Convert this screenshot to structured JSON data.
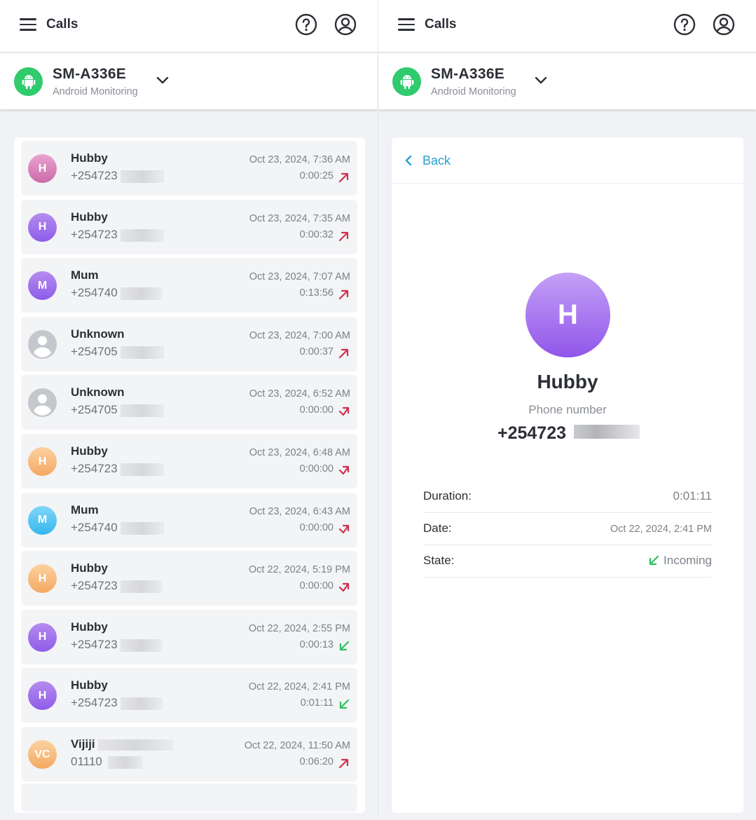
{
  "header": {
    "title": "Calls"
  },
  "device": {
    "name": "SM-A336E",
    "subtitle": "Android Monitoring"
  },
  "calls": [
    {
      "name": "Hubby",
      "number": "+254723",
      "date": "Oct 23, 2024, 7:36 AM",
      "duration": "0:00:25",
      "direction": "outgoing",
      "avatar_initials": "H",
      "avatar_color": "#c96aa8"
    },
    {
      "name": "Hubby",
      "number": "+254723",
      "date": "Oct 23, 2024, 7:35 AM",
      "duration": "0:00:32",
      "direction": "outgoing",
      "avatar_initials": "H",
      "avatar_color": "#8e5ce8"
    },
    {
      "name": "Mum",
      "number": "+254740",
      "date": "Oct 23, 2024, 7:07 AM",
      "duration": "0:13:56",
      "direction": "outgoing",
      "avatar_initials": "M",
      "avatar_color": "#8e5ce8"
    },
    {
      "name": "Unknown",
      "number": "+254705",
      "date": "Oct 23, 2024, 7:00 AM",
      "duration": "0:00:37",
      "direction": "outgoing",
      "avatar_initials": "",
      "avatar_color": "#c4c7cc"
    },
    {
      "name": "Unknown",
      "number": "+254705",
      "date": "Oct 23, 2024, 6:52 AM",
      "duration": "0:00:00",
      "direction": "missed-outgoing",
      "avatar_initials": "",
      "avatar_color": "#c4c7cc"
    },
    {
      "name": "Hubby",
      "number": "+254723",
      "date": "Oct 23, 2024, 6:48 AM",
      "duration": "0:00:00",
      "direction": "missed-outgoing",
      "avatar_initials": "H",
      "avatar_color": "#f5a962"
    },
    {
      "name": "Mum",
      "number": "+254740",
      "date": "Oct 23, 2024, 6:43 AM",
      "duration": "0:00:00",
      "direction": "missed-outgoing",
      "avatar_initials": "M",
      "avatar_color": "#35b7ef"
    },
    {
      "name": "Hubby",
      "number": "+254723",
      "date": "Oct 22, 2024, 5:19 PM",
      "duration": "0:00:00",
      "direction": "missed-outgoing",
      "avatar_initials": "H",
      "avatar_color": "#f5a962"
    },
    {
      "name": "Hubby",
      "number": "+254723",
      "date": "Oct 22, 2024, 2:55 PM",
      "duration": "0:00:13",
      "direction": "incoming",
      "avatar_initials": "H",
      "avatar_color": "#8e5ce8"
    },
    {
      "name": "Hubby",
      "number": "+254723",
      "date": "Oct 22, 2024, 2:41 PM",
      "duration": "0:01:11",
      "direction": "incoming",
      "avatar_initials": "H",
      "avatar_color": "#8e5ce8"
    },
    {
      "name": "Vijiji",
      "number": "01110",
      "date": "Oct 22, 2024, 11:50 AM",
      "duration": "0:06:20",
      "direction": "outgoing",
      "avatar_initials": "VC",
      "avatar_color": "#f5a962"
    }
  ],
  "detail": {
    "back_label": "Back",
    "avatar_initials": "H",
    "name": "Hubby",
    "phone_label": "Phone number",
    "phone_number": "+254723",
    "duration_label": "Duration:",
    "duration_value": "0:01:11",
    "date_label": "Date:",
    "date_value": "Oct 22, 2024, 2:41 PM",
    "state_label": "State:",
    "state_value": "Incoming"
  },
  "colors": {
    "accent": "#2a9fd0",
    "outgoing": "#d0304c",
    "incoming": "#2fbf5f",
    "android": "#2fcb6d"
  }
}
